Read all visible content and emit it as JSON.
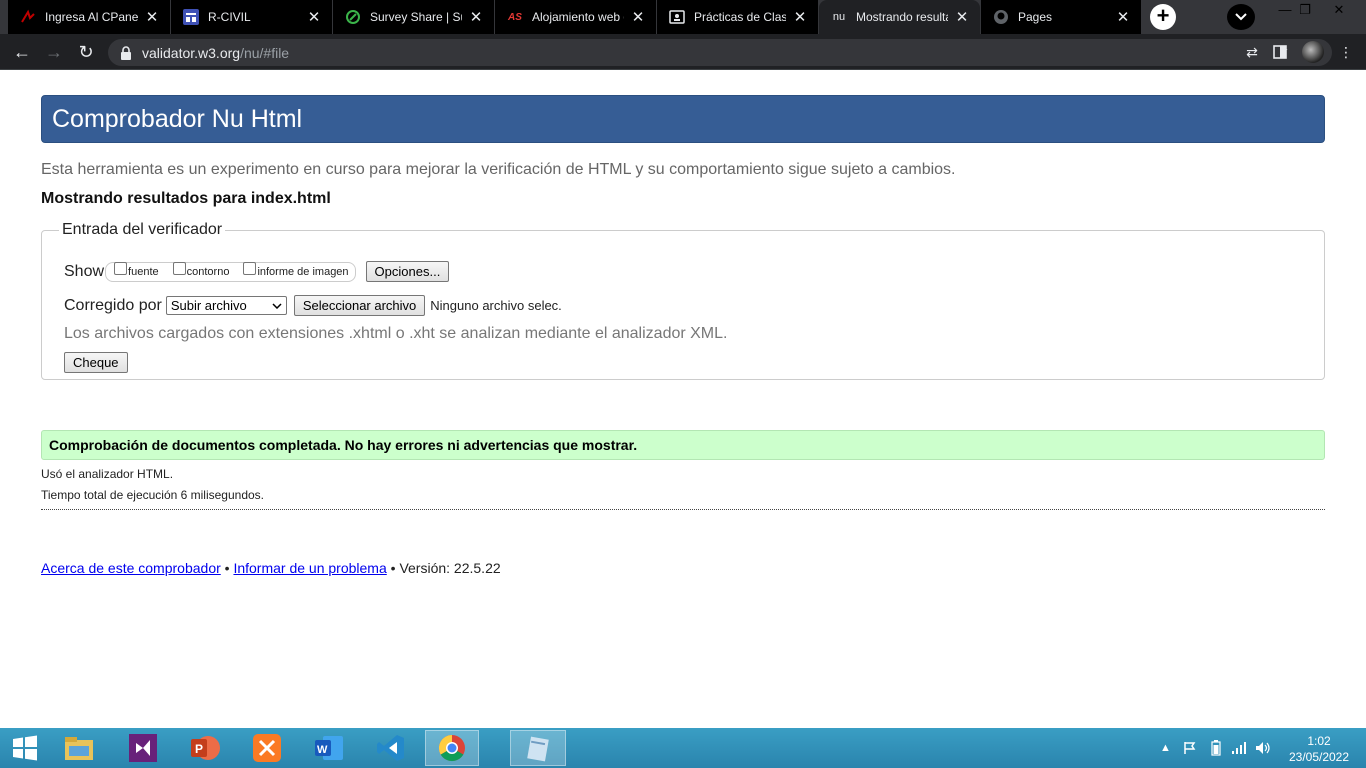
{
  "browser": {
    "tabs": [
      {
        "title": "Ingresa Al CPanel",
        "icon": "cpanel-icon",
        "color": "#c00000"
      },
      {
        "title": "R-CIVIL",
        "icon": "form-icon",
        "color": "#3f51b5"
      },
      {
        "title": "Survey Share | Sur",
        "icon": "surveyshare-icon",
        "color": "#3bb44a"
      },
      {
        "title": "Alojamiento web g",
        "icon": "as-icon",
        "color": "#e53935"
      },
      {
        "title": "Prácticas de Clase",
        "icon": "classroom-icon",
        "color": "#e8eaed"
      },
      {
        "title": "Mostrando resulta",
        "icon": "nu-icon",
        "color": "#e8eaed"
      },
      {
        "title": "Pages",
        "icon": "github-icon",
        "color": "#9aa0a6"
      }
    ],
    "url_host": "validator.w3.org",
    "url_path": "/nu/#file"
  },
  "page": {
    "title": "Comprobador Nu Html",
    "intro": "Esta herramienta es un experimento en curso para mejorar la verificación de HTML y su comportamiento sigue sujeto a cambios.",
    "results_heading": "Mostrando resultados para index.html",
    "form": {
      "legend": "Entrada del verificador",
      "show_label": "Show",
      "checkboxes": [
        "fuente",
        "contorno",
        "informe de imagen"
      ],
      "options_button": "Opciones...",
      "checked_by_label": "Corregido por",
      "select_value": "Subir archivo",
      "file_button": "Seleccionar archivo",
      "file_status": "Ninguno archivo selec.",
      "hint": "Los archivos cargados con extensiones .xhtml o .xht se analizan mediante el analizador XML.",
      "check_button": "Cheque"
    },
    "success_message": "Comprobación de documentos completada. No hay errores ni advertencias que mostrar.",
    "parser_note": "Usó el analizador HTML.",
    "timing_note": "Tiempo total de ejecución 6 milisegundos.",
    "footer": {
      "about_link": "Acerca de este comprobador",
      "separator": "•",
      "report_link": "Informar de un problema",
      "version": "Versión: 22.5.22"
    }
  },
  "taskbar": {
    "time": "1:02",
    "date": "23/05/2022",
    "apps": [
      "file-explorer-icon",
      "visual-studio-icon",
      "powerpoint-icon",
      "xampp-icon",
      "word-icon",
      "vscode-icon",
      "chrome-icon",
      "notepad-icon"
    ]
  },
  "colors": {
    "banner": "#365d95",
    "success_bg": "#ccffcc",
    "link": "#0000ee"
  }
}
